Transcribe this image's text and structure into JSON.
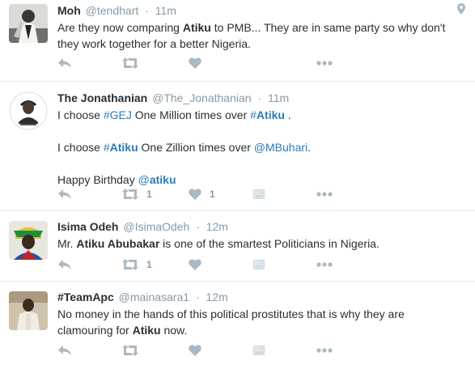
{
  "tweets": [
    {
      "name": "Moh",
      "handle": "@tendhart",
      "time": "11m",
      "lines": [
        [
          "Are they now comparing ",
          {
            "b": "Atiku"
          },
          " to PMB...  They are in same party so why don't"
        ],
        [
          "they work together for a better Nigeria."
        ]
      ],
      "retweets": "",
      "likes": ""
    },
    {
      "name": "The Jonathanian",
      "handle": "@The_Jonathanian",
      "time": "11m",
      "lines": [
        [
          "I choose ",
          {
            "tag": "#GEJ"
          },
          " One Million times over ",
          {
            "tag": "#",
            "b": "Atiku"
          },
          " ."
        ],
        [
          "I choose ",
          {
            "tag": "#",
            "b": "Atiku"
          },
          " One Zillion times over ",
          {
            "tag": "@MBuhari"
          },
          "."
        ],
        [
          "Happy Birthday ",
          {
            "tag": "@",
            "b": "atiku"
          }
        ]
      ],
      "retweets": "1",
      "likes": "1"
    },
    {
      "name": "Isima Odeh",
      "handle": "@IsimaOdeh",
      "time": "12m",
      "lines": [
        [
          "Mr. ",
          {
            "b": "Atiku Abubakar"
          },
          " is one of the smartest Politicians in Nigeria."
        ]
      ],
      "retweets": "1",
      "likes": ""
    },
    {
      "name": "#TeamApc",
      "handle": "@mainasara1",
      "time": "12m",
      "lines": [
        [
          "No money in the hands of this political prostitutes that is why they are"
        ],
        [
          "clamouring for ",
          {
            "b": "Atiku"
          },
          " now."
        ]
      ],
      "retweets": "",
      "likes": ""
    }
  ],
  "icons": {
    "reply": "reply-icon",
    "retweet": "retweet-icon",
    "like": "heart-icon",
    "media": "photo-icon",
    "more": "more-dots-icon",
    "location": "location-pin-icon"
  },
  "colors": {
    "text": "#292f33",
    "muted": "#8899a6",
    "link": "#2b7bb9",
    "icon": "#aab8c2",
    "divider": "#e1e8ed"
  }
}
